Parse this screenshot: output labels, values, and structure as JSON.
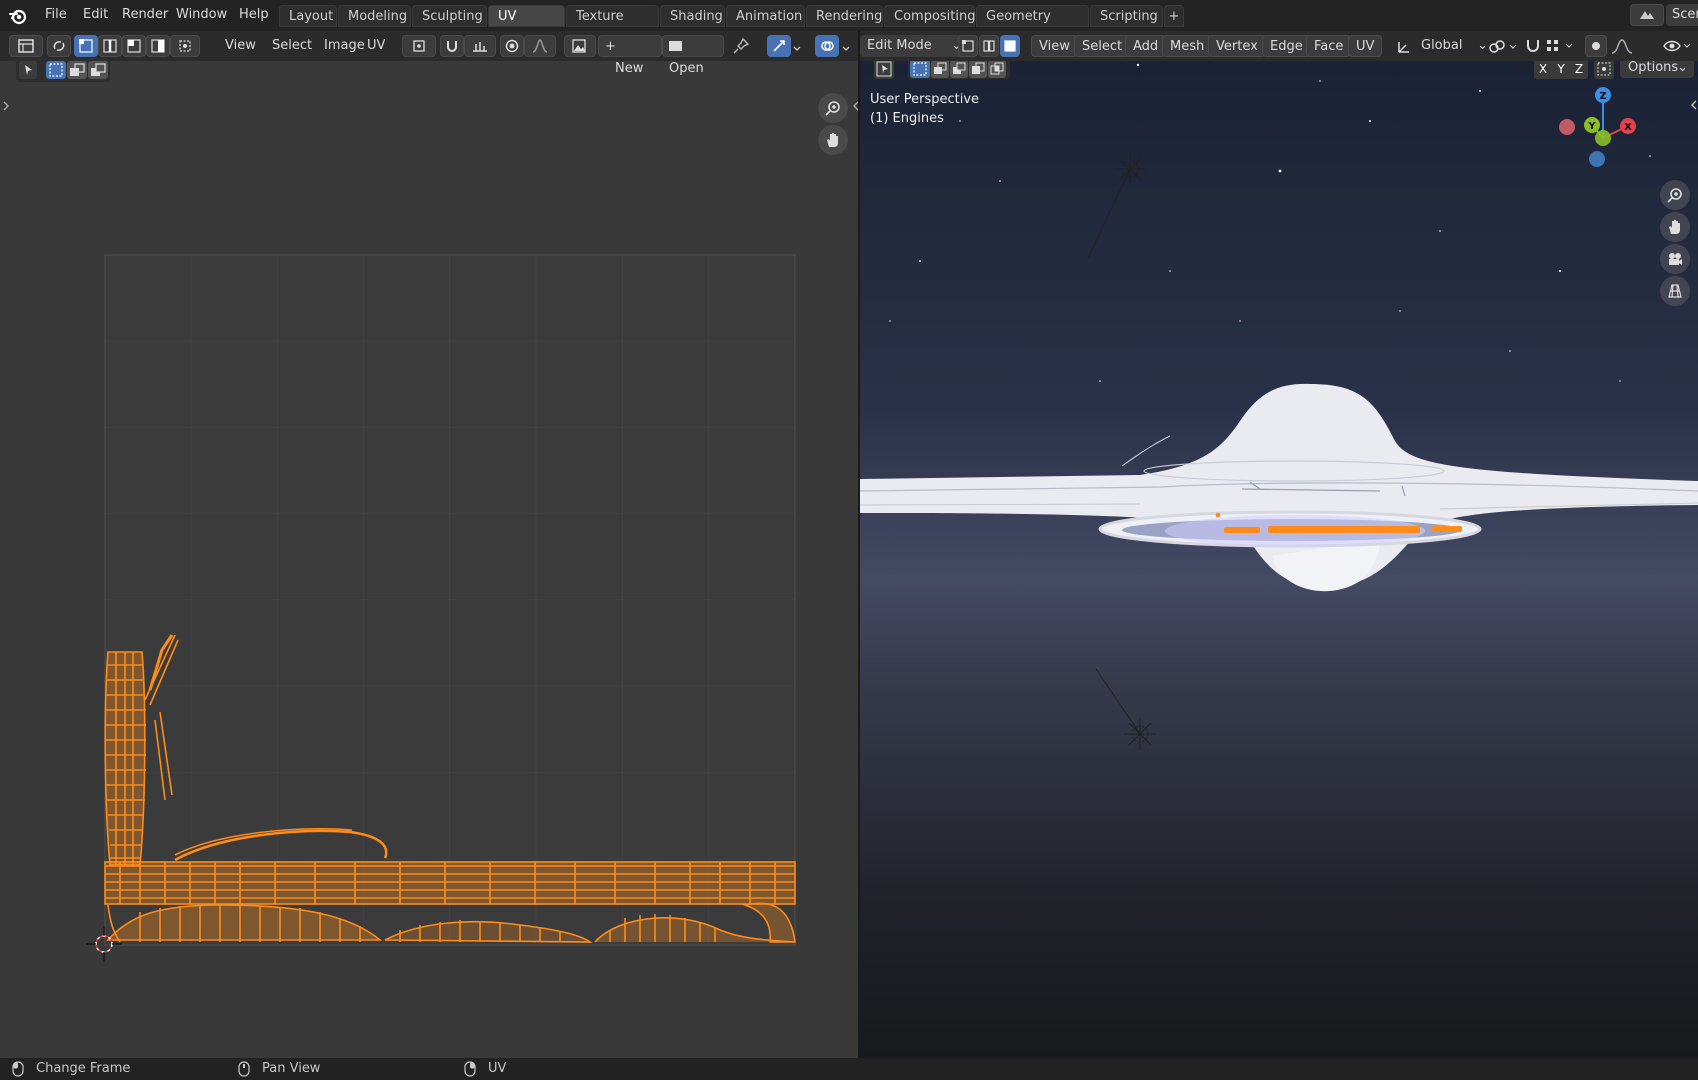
{
  "app": {
    "logo": "blender-logo-icon"
  },
  "menu": {
    "items": [
      {
        "label": "File"
      },
      {
        "label": "Edit"
      },
      {
        "label": "Render"
      },
      {
        "label": "Window"
      },
      {
        "label": "Help"
      }
    ]
  },
  "workspaces": {
    "tabs": [
      {
        "label": "Layout"
      },
      {
        "label": "Modeling"
      },
      {
        "label": "Sculpting"
      },
      {
        "label": "UV Editing",
        "active": true
      },
      {
        "label": "Texture Paint"
      },
      {
        "label": "Shading"
      },
      {
        "label": "Animation"
      },
      {
        "label": "Rendering"
      },
      {
        "label": "Compositing"
      },
      {
        "label": "Geometry Nodes"
      },
      {
        "label": "Scripting"
      }
    ],
    "add_label": "+",
    "scene_label": "Scen"
  },
  "uv_header": {
    "view": "View",
    "select": "Select",
    "image": "Image",
    "uv": "UV",
    "new": "New",
    "new_prefix": "+",
    "open": "Open"
  },
  "viewport_header": {
    "mode": "Edit Mode",
    "view": "View",
    "select": "Select",
    "add": "Add",
    "mesh": "Mesh",
    "vertex": "Vertex",
    "edge": "Edge",
    "face": "Face",
    "uv": "UV",
    "orientation": "Global",
    "axis_x": "X",
    "axis_y": "Y",
    "axis_z": "Z",
    "options": "Options"
  },
  "viewport_overlay": {
    "perspective": "User Perspective",
    "object": "(1) Engines"
  },
  "gizmo": {
    "z": "Z",
    "y": "Y",
    "x": "X"
  },
  "status_bar": {
    "left": "Change Frame",
    "middle": "Pan View",
    "right": "UV"
  },
  "colors": {
    "uv_orange": "#ff8c1a",
    "active_blue": "#4772b3",
    "axis_x": "#e0434e",
    "axis_y": "#8bbf2a",
    "axis_z": "#3a8ee6"
  }
}
